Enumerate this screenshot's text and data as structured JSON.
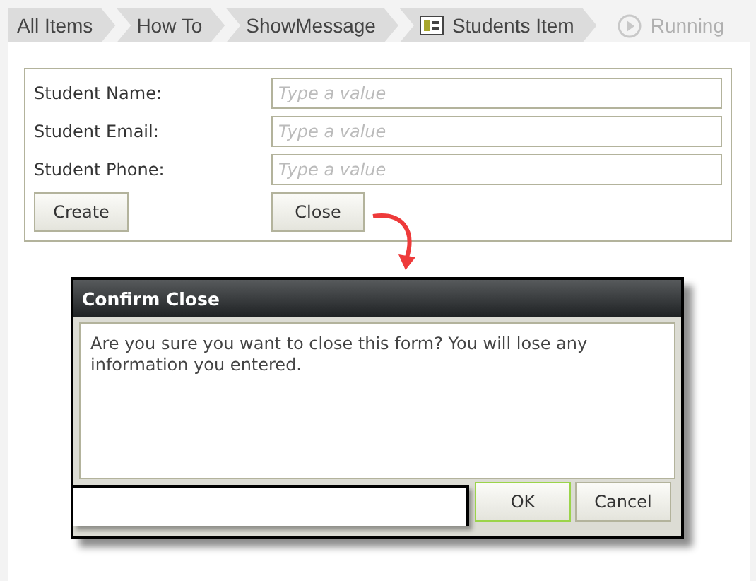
{
  "breadcrumb": [
    {
      "label": "All Items",
      "kind": "link"
    },
    {
      "label": "How To",
      "kind": "link"
    },
    {
      "label": "ShowMessage",
      "kind": "link"
    },
    {
      "label": "Students Item",
      "kind": "form"
    },
    {
      "label": "Running",
      "kind": "status"
    }
  ],
  "form": {
    "fields": [
      {
        "label": "Student Name:",
        "placeholder": "Type a value"
      },
      {
        "label": "Student Email:",
        "placeholder": "Type a value"
      },
      {
        "label": "Student Phone:",
        "placeholder": "Type a value"
      }
    ],
    "buttons": [
      "Create",
      "Close"
    ]
  },
  "dialog": {
    "title": "Confirm Close",
    "message": "Are you sure you want to close this form? You will lose any information you entered.",
    "buttons": [
      {
        "label": "OK",
        "focused": true
      },
      {
        "label": "Cancel",
        "focused": false
      }
    ]
  }
}
